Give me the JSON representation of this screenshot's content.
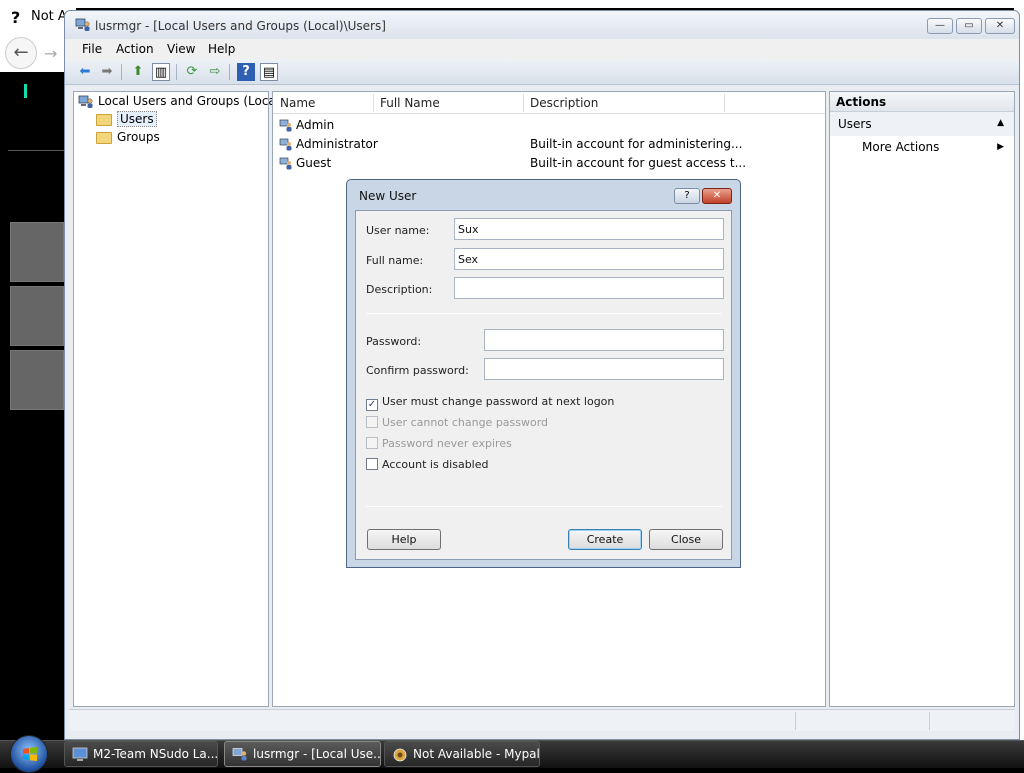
{
  "background_browser": {
    "tab_title": "Not Available - Mypal",
    "tab_icon": "?",
    "back_glyph": "←",
    "forward_glyph": "→"
  },
  "window": {
    "title": "lusrmgr - [Local Users and Groups (Local)\\Users]",
    "min_glyph": "—",
    "max_glyph": "▭",
    "close_glyph": "✕"
  },
  "menu": [
    "File",
    "Action",
    "View",
    "Help"
  ],
  "toolbar": {
    "back": "⬅",
    "forward": "➡",
    "up": "⬆",
    "show_hide": "▥",
    "refresh": "⟳",
    "export": "⇨",
    "help": "?",
    "show_hide2": "▤"
  },
  "tree": {
    "root": "Local Users and Groups (Local)",
    "nodes": [
      "Users",
      "Groups"
    ],
    "selected": "Users"
  },
  "list": {
    "columns": [
      "Name",
      "Full Name",
      "Description"
    ],
    "rows": [
      {
        "name": "Admin",
        "full_name": "",
        "description": ""
      },
      {
        "name": "Administrator",
        "full_name": "",
        "description": "Built-in account for administering..."
      },
      {
        "name": "Guest",
        "full_name": "",
        "description": "Built-in account for guest access t..."
      }
    ]
  },
  "actions": {
    "header": "Actions",
    "section": "Users",
    "section_arrow": "▲",
    "more": "More Actions",
    "more_arrow": "▶"
  },
  "dialog": {
    "title": "New User",
    "help_glyph": "?",
    "close_glyph": "✕",
    "fields": {
      "user_name_label": "User name:",
      "user_name_value": "Sux",
      "full_name_label": "Full name:",
      "full_name_value": "Sex",
      "description_label": "Description:",
      "description_value": "",
      "password_label": "Password:",
      "password_value": "",
      "confirm_label": "Confirm password:",
      "confirm_value": ""
    },
    "checkboxes": [
      {
        "label": "User must change password at next logon",
        "checked": true,
        "enabled": true
      },
      {
        "label": "User cannot change password",
        "checked": false,
        "enabled": false
      },
      {
        "label": "Password never expires",
        "checked": false,
        "enabled": false
      },
      {
        "label": "Account is disabled",
        "checked": false,
        "enabled": true
      }
    ],
    "check_glyph": "✓",
    "buttons": {
      "help": "Help",
      "create": "Create",
      "close": "Close"
    }
  },
  "taskbar": {
    "items": [
      {
        "label": "M2-Team NSudo La...",
        "active": false
      },
      {
        "label": "lusrmgr - [Local Use...",
        "active": true
      },
      {
        "label": "Not Available - Mypal",
        "active": false
      }
    ]
  },
  "colors": {
    "window_frame": "#7b8ea6",
    "dialog_frame": "#c9d6e5",
    "close_red": "#c2412a",
    "taskbar": "#111111"
  }
}
